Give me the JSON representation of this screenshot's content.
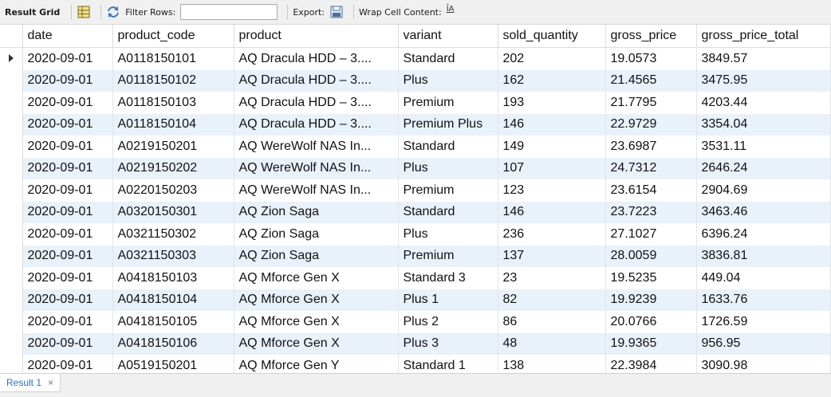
{
  "toolbar": {
    "result_grid": "Result Grid",
    "filter_rows": "Filter Rows:",
    "filter_value": "",
    "export": "Export:",
    "wrap": "Wrap Cell Content:",
    "wrap_icon_glyph": "ĪA"
  },
  "grid": {
    "columns": [
      "date",
      "product_code",
      "product",
      "variant",
      "sold_quantity",
      "gross_price",
      "gross_price_total"
    ],
    "rows": [
      [
        "2020-09-01",
        "A0118150101",
        "AQ Dracula HDD – 3....",
        "Standard",
        "202",
        "19.0573",
        "3849.57"
      ],
      [
        "2020-09-01",
        "A0118150102",
        "AQ Dracula HDD – 3....",
        "Plus",
        "162",
        "21.4565",
        "3475.95"
      ],
      [
        "2020-09-01",
        "A0118150103",
        "AQ Dracula HDD – 3....",
        "Premium",
        "193",
        "21.7795",
        "4203.44"
      ],
      [
        "2020-09-01",
        "A0118150104",
        "AQ Dracula HDD – 3....",
        "Premium Plus",
        "146",
        "22.9729",
        "3354.04"
      ],
      [
        "2020-09-01",
        "A0219150201",
        "AQ WereWolf NAS In...",
        "Standard",
        "149",
        "23.6987",
        "3531.11"
      ],
      [
        "2020-09-01",
        "A0219150202",
        "AQ WereWolf NAS In...",
        "Plus",
        "107",
        "24.7312",
        "2646.24"
      ],
      [
        "2020-09-01",
        "A0220150203",
        "AQ WereWolf NAS In...",
        "Premium",
        "123",
        "23.6154",
        "2904.69"
      ],
      [
        "2020-09-01",
        "A0320150301",
        "AQ Zion Saga",
        "Standard",
        "146",
        "23.7223",
        "3463.46"
      ],
      [
        "2020-09-01",
        "A0321150302",
        "AQ Zion Saga",
        "Plus",
        "236",
        "27.1027",
        "6396.24"
      ],
      [
        "2020-09-01",
        "A0321150303",
        "AQ Zion Saga",
        "Premium",
        "137",
        "28.0059",
        "3836.81"
      ],
      [
        "2020-09-01",
        "A0418150103",
        "AQ Mforce Gen X",
        "Standard 3",
        "23",
        "19.5235",
        "449.04"
      ],
      [
        "2020-09-01",
        "A0418150104",
        "AQ Mforce Gen X",
        "Plus 1",
        "82",
        "19.9239",
        "1633.76"
      ],
      [
        "2020-09-01",
        "A0418150105",
        "AQ Mforce Gen X",
        "Plus 2",
        "86",
        "20.0766",
        "1726.59"
      ],
      [
        "2020-09-01",
        "A0418150106",
        "AQ Mforce Gen X",
        "Plus 3",
        "48",
        "19.9365",
        "956.95"
      ],
      [
        "2020-09-01",
        "A0519150201",
        "AQ Mforce Gen Y",
        "Standard 1",
        "138",
        "22.3984",
        "3090.98"
      ]
    ]
  },
  "tabs": [
    {
      "label": "Result 1",
      "close": "×"
    }
  ],
  "colors": {
    "alt_row": "#e9f1fb",
    "tab_text": "#2a6fd0",
    "toolbar_bg": "#f0f0f0"
  }
}
